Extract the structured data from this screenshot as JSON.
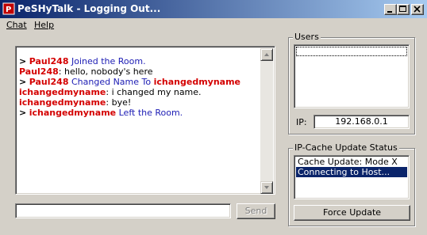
{
  "window": {
    "title": "PeSHyTalk - Logging Out..."
  },
  "menu": {
    "chat": "Chat",
    "help": "Help"
  },
  "chat_log": [
    {
      "type": "system",
      "marker": ">",
      "nick": "Paul248",
      "text": " Joined the Room."
    },
    {
      "type": "message",
      "nick": "Paul248",
      "text": ": hello, nobody's here"
    },
    {
      "type": "system_rename",
      "marker": ">",
      "nick": "Paul248",
      "text": " Changed Name To ",
      "nick2": "ichangedmyname"
    },
    {
      "type": "message",
      "nick": "ichangedmyname",
      "text": ": i changed my name."
    },
    {
      "type": "message",
      "nick": "ichangedmyname",
      "text": ": bye!"
    },
    {
      "type": "system",
      "marker": ">",
      "nick": "ichangedmyname",
      "text": " Left the Room."
    }
  ],
  "message_input": {
    "value": ""
  },
  "send_button": {
    "label": "Send"
  },
  "users": {
    "label": "Users",
    "items": []
  },
  "ip": {
    "label": "IP:",
    "value": "192.168.0.1"
  },
  "cache": {
    "label": "IP-Cache Update Status",
    "items": [
      "Cache Update: Mode X",
      "Connecting to Host..."
    ]
  },
  "force_update_button": {
    "label": "Force Update"
  },
  "colors": {
    "nick": "#d40000",
    "system_text": "#1c1cb4",
    "selection": "#0a246a"
  }
}
